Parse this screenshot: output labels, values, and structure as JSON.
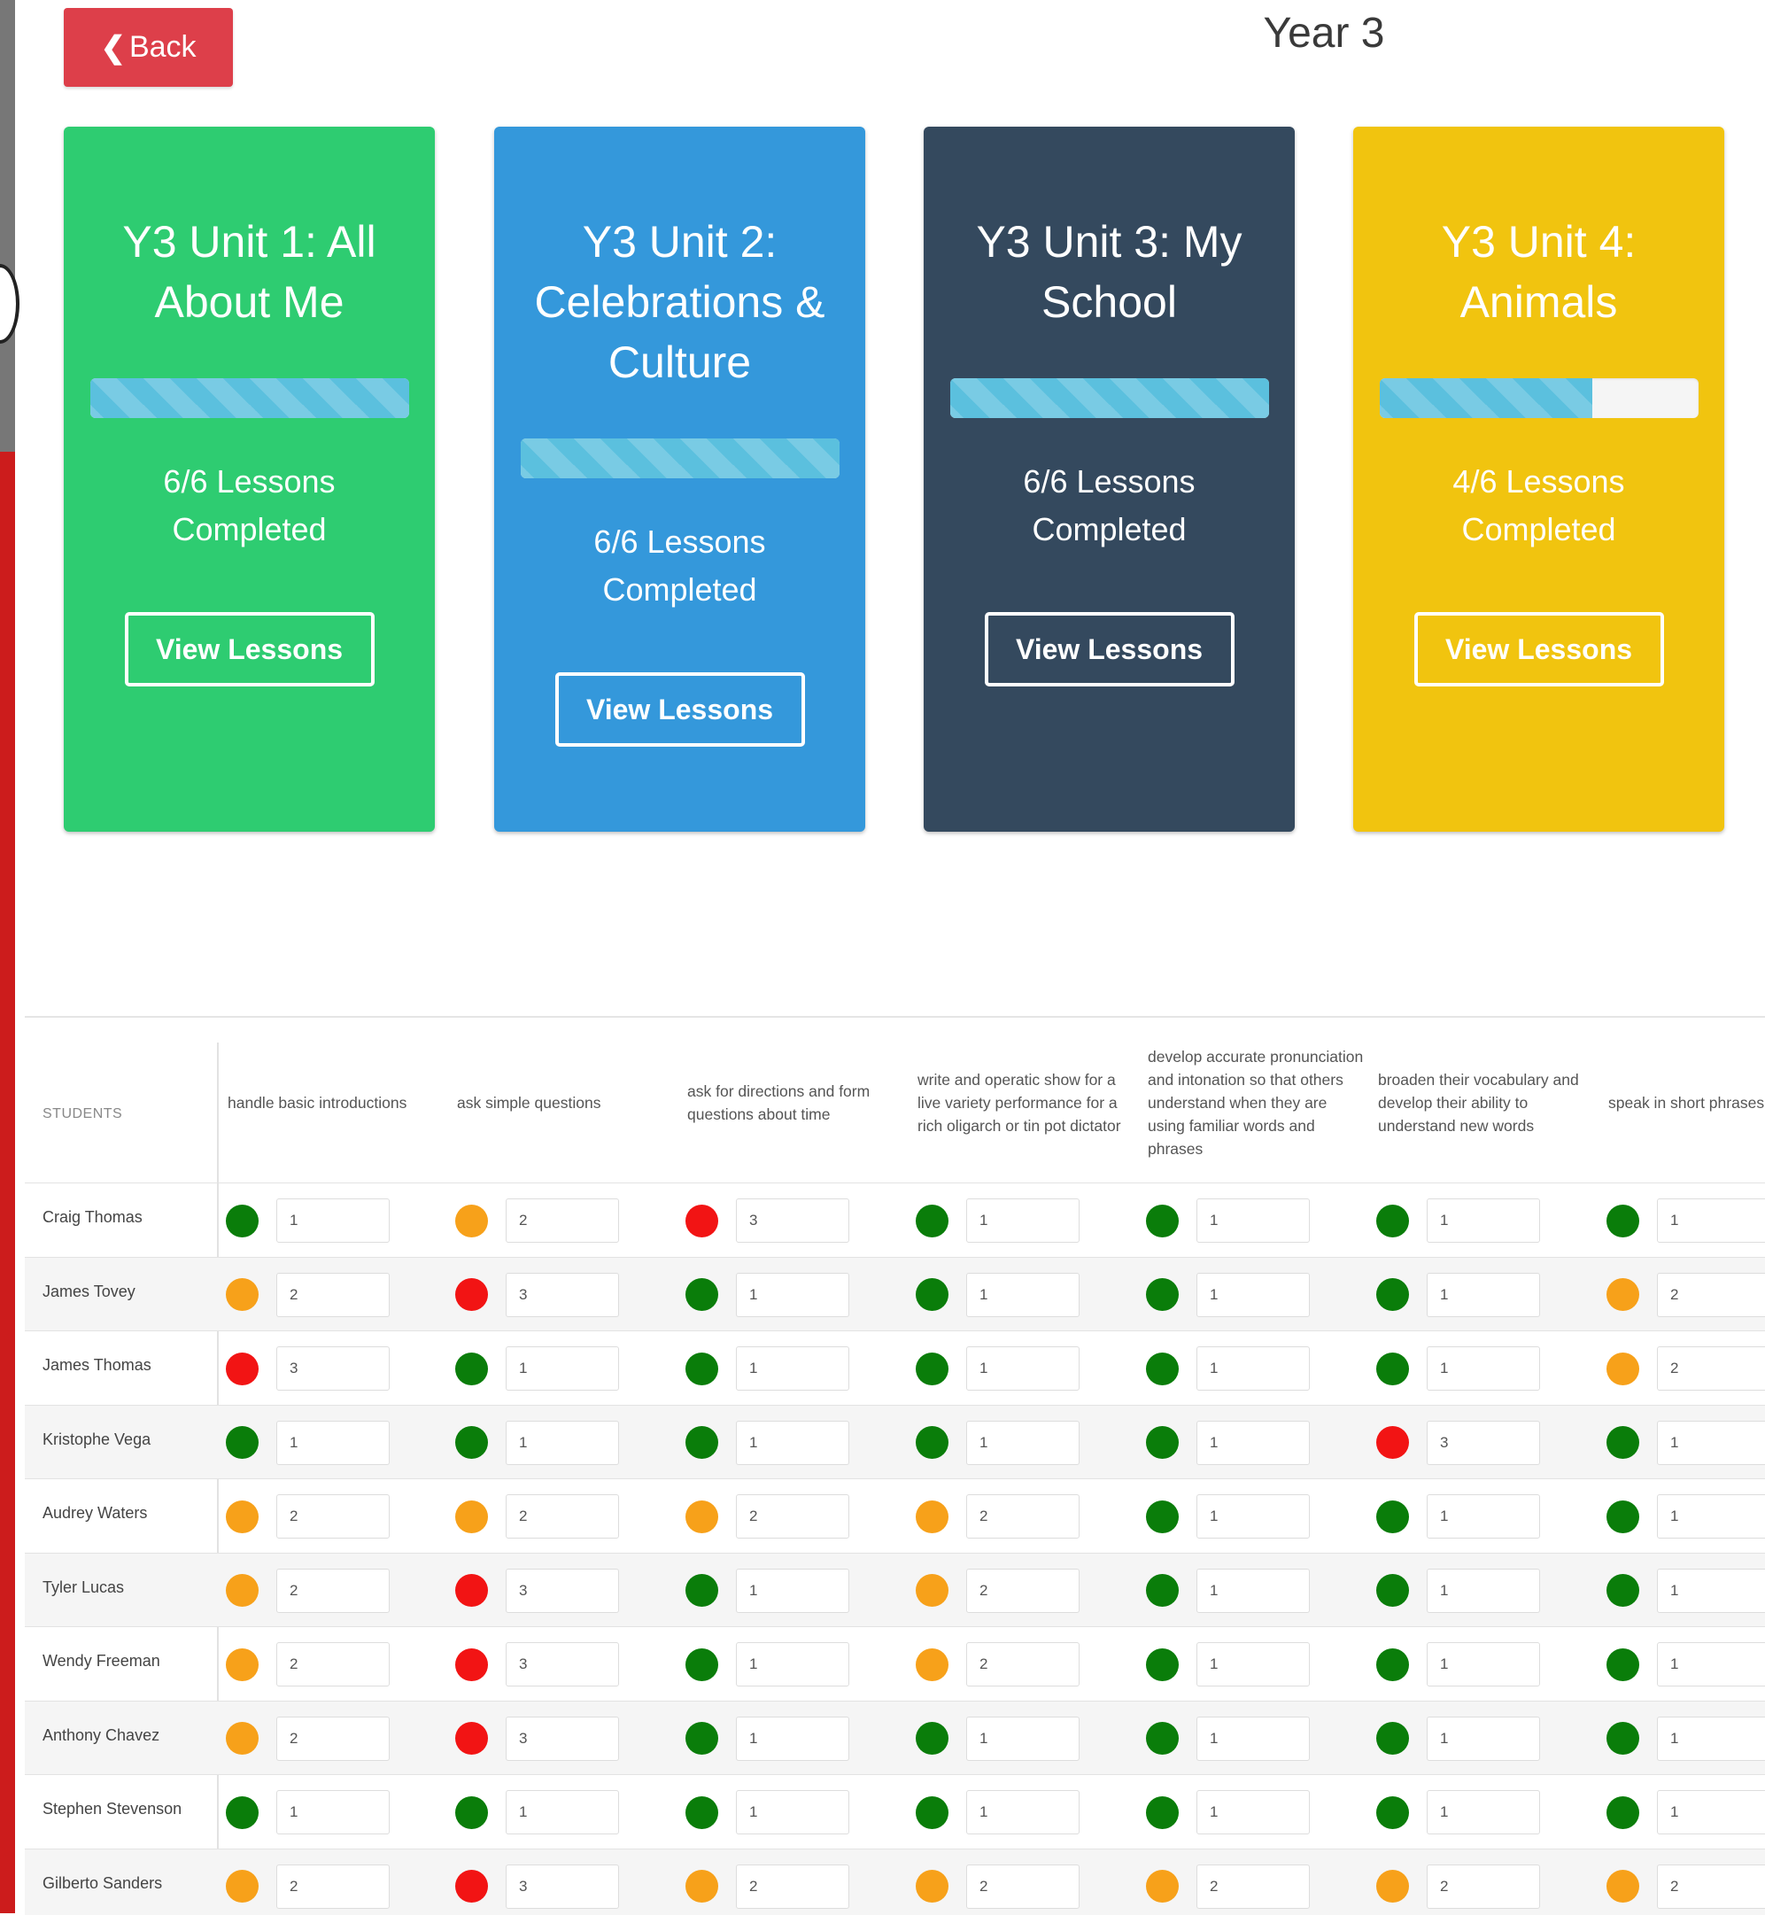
{
  "page": {
    "title": "Year 3"
  },
  "back": {
    "label": "Back",
    "icon": "chevron-left-icon"
  },
  "units": [
    {
      "title": "Y3 Unit 1: All About Me",
      "lessons": "6/6 Lessons Completed",
      "button": "View Lessons",
      "progress": 1.0,
      "color": "#2ecc71"
    },
    {
      "title": "Y3 Unit 2: Celebrations & Culture",
      "lessons": "6/6 Lessons Completed",
      "button": "View Lessons",
      "progress": 1.0,
      "color": "#3498db"
    },
    {
      "title": "Y3 Unit 3: My School",
      "lessons": "6/6 Lessons Completed",
      "button": "View Lessons",
      "progress": 1.0,
      "color": "#34495e"
    },
    {
      "title": "Y3 Unit 4: Animals",
      "lessons": "4/6 Lessons Completed",
      "button": "View Lessons",
      "progress": 0.6667,
      "color": "#f1c40f"
    }
  ],
  "table": {
    "students_label": "STUDENTS",
    "columns": [
      "handle basic introductions",
      "ask simple questions",
      "ask for directions and form questions about time",
      "write and operatic show for a live variety performance for a rich oligarch or tin pot dictator",
      "develop accurate pronunciation and intonation so that others understand when they are using familiar words and phrases",
      "broaden their vocabulary and develop their ability to understand new words",
      "speak in short phrases"
    ],
    "status_colors": {
      "1": "#0a7d0a",
      "2": "#f7a11a",
      "3": "#f21414"
    },
    "rows": [
      {
        "name": "Craig Thomas",
        "scores": [
          "1",
          "2",
          "3",
          "1",
          "1",
          "1",
          "1"
        ]
      },
      {
        "name": "James Tovey",
        "scores": [
          "2",
          "3",
          "1",
          "1",
          "1",
          "1",
          "2"
        ]
      },
      {
        "name": "James Thomas",
        "scores": [
          "3",
          "1",
          "1",
          "1",
          "1",
          "1",
          "2"
        ]
      },
      {
        "name": "Kristophe Vega",
        "scores": [
          "1",
          "1",
          "1",
          "1",
          "1",
          "3",
          "1"
        ]
      },
      {
        "name": "Audrey Waters",
        "scores": [
          "2",
          "2",
          "2",
          "2",
          "1",
          "1",
          "1"
        ]
      },
      {
        "name": "Tyler Lucas",
        "scores": [
          "2",
          "3",
          "1",
          "2",
          "1",
          "1",
          "1"
        ]
      },
      {
        "name": "Wendy Freeman",
        "scores": [
          "2",
          "3",
          "1",
          "2",
          "1",
          "1",
          "1"
        ]
      },
      {
        "name": "Anthony Chavez",
        "scores": [
          "2",
          "3",
          "1",
          "1",
          "1",
          "1",
          "1"
        ]
      },
      {
        "name": "Stephen Stevenson",
        "scores": [
          "1",
          "1",
          "1",
          "1",
          "1",
          "1",
          "1"
        ]
      },
      {
        "name": "Gilberto Sanders",
        "scores": [
          "2",
          "3",
          "2",
          "2",
          "2",
          "2",
          "2"
        ]
      }
    ]
  }
}
